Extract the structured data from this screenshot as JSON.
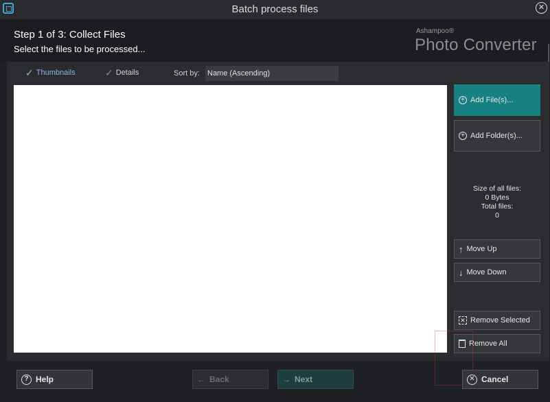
{
  "window": {
    "title": "Batch process files"
  },
  "header": {
    "step_title": "Step 1 of 3: Collect Files",
    "step_subtitle": "Select the files to be processed...",
    "brand_small": "Ashampoo®",
    "brand_big": "Photo Converter"
  },
  "viewbar": {
    "thumbnails_label": "Thumbnails",
    "details_label": "Details",
    "sort_label": "Sort by:",
    "sort_value": "Name (Ascending)"
  },
  "side": {
    "add_files": "Add File(s)...",
    "add_folders": "Add Folder(s)...",
    "size_label": "Size of all files:",
    "size_value": "0 Bytes",
    "total_label": "Total files:",
    "total_value": "0",
    "move_up": "Move Up",
    "move_down": "Move Down",
    "remove_selected": "Remove Selected",
    "remove_all": "Remove All"
  },
  "footer": {
    "help": "Help",
    "back": "Back",
    "next": "Next",
    "cancel": "Cancel"
  },
  "colors": {
    "accent": "#178080",
    "background": "#1f2023",
    "panel": "#2b2c30"
  }
}
